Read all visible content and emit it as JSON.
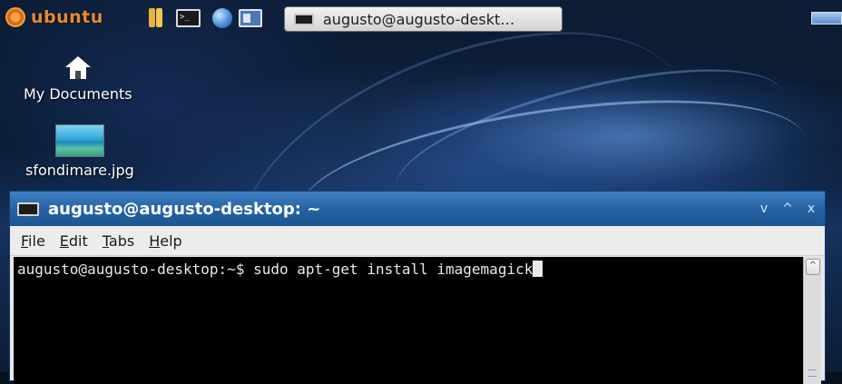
{
  "panel": {
    "menu_label": "ubuntu",
    "launchers": [
      "file-manager-icon",
      "terminal-icon",
      "web-browser-icon",
      "window-switcher-icon"
    ],
    "terminal_launcher_glyph": ">_",
    "taskbar_button_label": "augusto@augusto-deskt…"
  },
  "desktop": {
    "icons": [
      {
        "label": "My Documents",
        "icon": "home-icon"
      },
      {
        "label": "sfondimare.jpg",
        "icon": "image-file-icon"
      }
    ]
  },
  "terminal": {
    "title": "augusto@augusto-desktop: ~",
    "window_buttons": [
      "v",
      "^",
      "x"
    ],
    "menu": [
      {
        "mnemonic": "F",
        "rest": "ile"
      },
      {
        "mnemonic": "E",
        "rest": "dit"
      },
      {
        "mnemonic": "T",
        "rest": "abs"
      },
      {
        "mnemonic": "H",
        "rest": "elp"
      }
    ],
    "prompt": "augusto@augusto-desktop:~$ ",
    "command": "sudo apt-get install imagemagick",
    "scroll_up_glyph": "^"
  },
  "colors": {
    "panel_accent": "#e88a2e",
    "titlebar": "#2461a2",
    "terminal_bg": "#000000",
    "terminal_fg": "#e8e8e8"
  }
}
